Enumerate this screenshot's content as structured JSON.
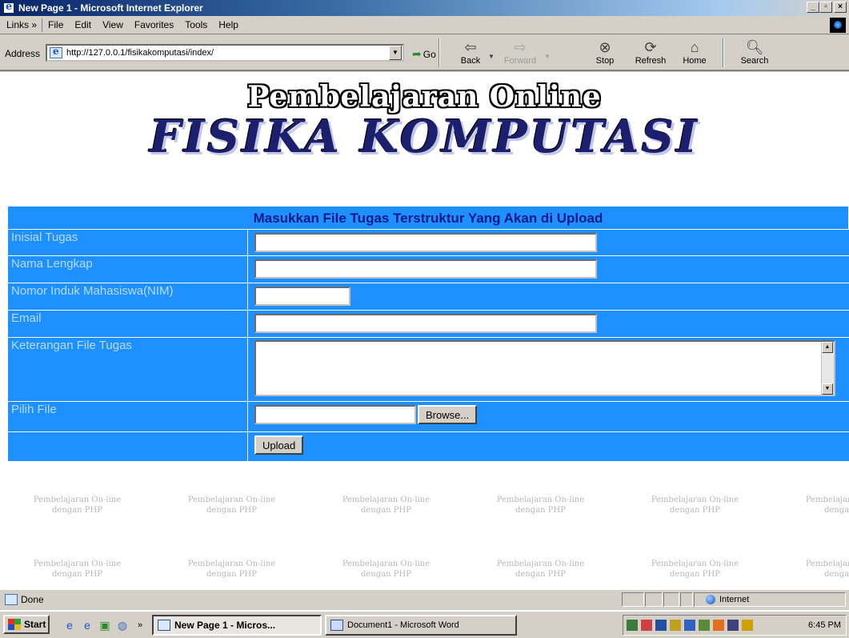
{
  "window": {
    "title": "New Page 1 - Microsoft Internet Explorer"
  },
  "menubar": {
    "links_label": "Links »",
    "items": [
      "File",
      "Edit",
      "View",
      "Favorites",
      "Tools",
      "Help"
    ]
  },
  "toolbar": {
    "address_label": "Address",
    "address_value": "http://127.0.0.1/fisikakomputasi/index/",
    "go_label": "Go",
    "back_label": "Back",
    "forward_label": "Forward",
    "stop_label": "Stop",
    "refresh_label": "Refresh",
    "home_label": "Home",
    "search_label": "Search"
  },
  "page": {
    "title_line1": "Pembelajaran Online",
    "title_line2": "FISIKA KOMPUTASI",
    "watermark_line1": "Pembelajaran On-line",
    "watermark_line2": "dengan PHP",
    "form": {
      "heading": "Masukkan File Tugas Terstruktur Yang Akan di Upload",
      "fields": {
        "inisial": "Inisial Tugas",
        "nama": "Nama Lengkap",
        "nim": "Nomor Induk Mahasiswa(NIM)",
        "email": "Email",
        "keterangan": "Keterangan File Tugas",
        "pilih_file": "Pilih File"
      },
      "browse_label": "Browse...",
      "upload_label": "Upload"
    }
  },
  "statusbar": {
    "status": "Done",
    "zone": "Internet"
  },
  "taskbar": {
    "start_label": "Start",
    "tasks": [
      "New Page 1 - Micros...",
      "Document1 - Microsoft Word"
    ],
    "clock": "6:45 PM"
  },
  "colors": {
    "form_bg": "#1e90ff",
    "heading_text": "#0a1a8a",
    "label_text": "#b8dcff",
    "title_dark": "#1b1f6e"
  }
}
